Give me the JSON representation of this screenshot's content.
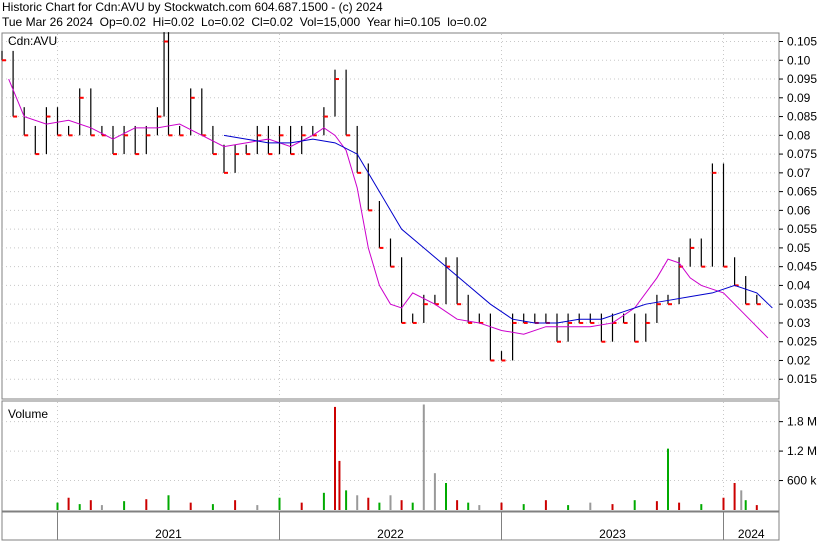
{
  "header": {
    "line1": "Historic Chart for Cdn:AVU by Stockwatch.com 604.687.1500 - (c) 2024",
    "line2": "Tue Mar 26 2024  Op=0.02  Hi=0.02  Lo=0.02  Cl=0.02  Vol=15,000  Year hi=0.105  lo=0.02"
  },
  "colors": {
    "bar": "#000000",
    "close_dot": "#ff0000",
    "ma_short": "#cc00cc",
    "ma_long": "#0000cc",
    "vol_up": "#00aa00",
    "vol_down": "#cc0000",
    "vol_flat": "#999999",
    "grid": "#c8c8c8"
  },
  "chart_data": [
    {
      "type": "line",
      "title": "Cdn:AVU",
      "ylim": [
        0.01,
        0.107
      ],
      "xlim": [
        2020.75,
        2024.25
      ],
      "x_ticks": [
        "2021",
        "2022",
        "2023",
        "2024"
      ],
      "y_ticks": [
        "0.105",
        "0.10",
        "0.095",
        "0.09",
        "0.085",
        "0.08",
        "0.075",
        "0.07",
        "0.065",
        "0.06",
        "0.055",
        "0.05",
        "0.045",
        "0.04",
        "0.035",
        "0.03",
        "0.025",
        "0.02",
        "0.015"
      ],
      "grid": true,
      "price_points": [
        [
          2020.75,
          0.1
        ],
        [
          2020.8,
          0.085
        ],
        [
          2020.85,
          0.08
        ],
        [
          2020.9,
          0.075
        ],
        [
          2020.95,
          0.085
        ],
        [
          2021.0,
          0.08
        ],
        [
          2021.05,
          0.08
        ],
        [
          2021.1,
          0.09
        ],
        [
          2021.15,
          0.08
        ],
        [
          2021.2,
          0.08
        ],
        [
          2021.25,
          0.075
        ],
        [
          2021.3,
          0.08
        ],
        [
          2021.35,
          0.075
        ],
        [
          2021.4,
          0.08
        ],
        [
          2021.45,
          0.085
        ],
        [
          2021.48,
          0.105
        ],
        [
          2021.5,
          0.08
        ],
        [
          2021.55,
          0.08
        ],
        [
          2021.6,
          0.09
        ],
        [
          2021.65,
          0.08
        ],
        [
          2021.7,
          0.075
        ],
        [
          2021.75,
          0.07
        ],
        [
          2021.8,
          0.075
        ],
        [
          2021.85,
          0.075
        ],
        [
          2021.9,
          0.08
        ],
        [
          2021.95,
          0.075
        ],
        [
          2022.0,
          0.08
        ],
        [
          2022.05,
          0.075
        ],
        [
          2022.1,
          0.08
        ],
        [
          2022.15,
          0.08
        ],
        [
          2022.2,
          0.085
        ],
        [
          2022.25,
          0.095
        ],
        [
          2022.3,
          0.08
        ],
        [
          2022.35,
          0.07
        ],
        [
          2022.4,
          0.06
        ],
        [
          2022.45,
          0.05
        ],
        [
          2022.5,
          0.045
        ],
        [
          2022.55,
          0.03
        ],
        [
          2022.6,
          0.03
        ],
        [
          2022.65,
          0.035
        ],
        [
          2022.7,
          0.035
        ],
        [
          2022.75,
          0.045
        ],
        [
          2022.8,
          0.035
        ],
        [
          2022.85,
          0.03
        ],
        [
          2022.9,
          0.03
        ],
        [
          2022.95,
          0.02
        ],
        [
          2023.0,
          0.02
        ],
        [
          2023.05,
          0.03
        ],
        [
          2023.1,
          0.03
        ],
        [
          2023.15,
          0.03
        ],
        [
          2023.2,
          0.03
        ],
        [
          2023.25,
          0.025
        ],
        [
          2023.3,
          0.03
        ],
        [
          2023.35,
          0.03
        ],
        [
          2023.4,
          0.03
        ],
        [
          2023.45,
          0.025
        ],
        [
          2023.5,
          0.03
        ],
        [
          2023.55,
          0.03
        ],
        [
          2023.6,
          0.025
        ],
        [
          2023.65,
          0.03
        ],
        [
          2023.7,
          0.035
        ],
        [
          2023.75,
          0.035
        ],
        [
          2023.8,
          0.045
        ],
        [
          2023.85,
          0.05
        ],
        [
          2023.9,
          0.045
        ],
        [
          2023.95,
          0.07
        ],
        [
          2024.0,
          0.045
        ],
        [
          2024.05,
          0.04
        ],
        [
          2024.1,
          0.035
        ],
        [
          2024.15,
          0.035
        ]
      ],
      "ma_short": [
        [
          2020.78,
          0.095
        ],
        [
          2020.85,
          0.085
        ],
        [
          2020.95,
          0.083
        ],
        [
          2021.05,
          0.084
        ],
        [
          2021.15,
          0.082
        ],
        [
          2021.25,
          0.079
        ],
        [
          2021.35,
          0.082
        ],
        [
          2021.45,
          0.082
        ],
        [
          2021.55,
          0.083
        ],
        [
          2021.65,
          0.08
        ],
        [
          2021.75,
          0.077
        ],
        [
          2021.85,
          0.078
        ],
        [
          2021.95,
          0.079
        ],
        [
          2022.05,
          0.077
        ],
        [
          2022.15,
          0.08
        ],
        [
          2022.2,
          0.082
        ],
        [
          2022.25,
          0.08
        ],
        [
          2022.3,
          0.076
        ],
        [
          2022.35,
          0.066
        ],
        [
          2022.4,
          0.05
        ],
        [
          2022.45,
          0.04
        ],
        [
          2022.5,
          0.035
        ],
        [
          2022.55,
          0.034
        ],
        [
          2022.6,
          0.038
        ],
        [
          2022.7,
          0.035
        ],
        [
          2022.8,
          0.031
        ],
        [
          2022.9,
          0.03
        ],
        [
          2023.0,
          0.028
        ],
        [
          2023.1,
          0.027
        ],
        [
          2023.2,
          0.029
        ],
        [
          2023.3,
          0.029
        ],
        [
          2023.4,
          0.029
        ],
        [
          2023.5,
          0.03
        ],
        [
          2023.6,
          0.034
        ],
        [
          2023.7,
          0.042
        ],
        [
          2023.75,
          0.047
        ],
        [
          2023.8,
          0.046
        ],
        [
          2023.85,
          0.042
        ],
        [
          2023.9,
          0.04
        ],
        [
          2023.95,
          0.039
        ],
        [
          2024.0,
          0.038
        ],
        [
          2024.05,
          0.035
        ],
        [
          2024.1,
          0.032
        ],
        [
          2024.15,
          0.029
        ],
        [
          2024.2,
          0.026
        ]
      ],
      "ma_long": [
        [
          2021.75,
          0.08
        ],
        [
          2021.85,
          0.079
        ],
        [
          2021.95,
          0.078
        ],
        [
          2022.05,
          0.078
        ],
        [
          2022.15,
          0.079
        ],
        [
          2022.25,
          0.078
        ],
        [
          2022.35,
          0.075
        ],
        [
          2022.45,
          0.065
        ],
        [
          2022.55,
          0.055
        ],
        [
          2022.65,
          0.05
        ],
        [
          2022.75,
          0.045
        ],
        [
          2022.85,
          0.04
        ],
        [
          2022.95,
          0.035
        ],
        [
          2023.05,
          0.031
        ],
        [
          2023.15,
          0.03
        ],
        [
          2023.25,
          0.03
        ],
        [
          2023.35,
          0.031
        ],
        [
          2023.45,
          0.031
        ],
        [
          2023.55,
          0.033
        ],
        [
          2023.65,
          0.035
        ],
        [
          2023.75,
          0.036
        ],
        [
          2023.85,
          0.037
        ],
        [
          2023.95,
          0.038
        ],
        [
          2024.05,
          0.04
        ],
        [
          2024.15,
          0.038
        ],
        [
          2024.22,
          0.034
        ]
      ]
    },
    {
      "type": "bar",
      "title": "Volume",
      "ylim": [
        0,
        2200000
      ],
      "y_ticks": [
        "1.8 M",
        "1.2 M",
        "600 k"
      ],
      "y_tick_values": [
        1800000,
        1200000,
        600000
      ],
      "volume_bars": [
        [
          2021.0,
          150000,
          "up"
        ],
        [
          2021.05,
          250000,
          "down"
        ],
        [
          2021.1,
          120000,
          "up"
        ],
        [
          2021.15,
          200000,
          "down"
        ],
        [
          2021.2,
          100000,
          "flat"
        ],
        [
          2021.3,
          180000,
          "up"
        ],
        [
          2021.4,
          220000,
          "down"
        ],
        [
          2021.5,
          300000,
          "up"
        ],
        [
          2021.6,
          150000,
          "down"
        ],
        [
          2021.7,
          120000,
          "up"
        ],
        [
          2021.8,
          200000,
          "down"
        ],
        [
          2021.9,
          100000,
          "flat"
        ],
        [
          2022.0,
          250000,
          "up"
        ],
        [
          2022.1,
          150000,
          "down"
        ],
        [
          2022.2,
          350000,
          "up"
        ],
        [
          2022.25,
          2100000,
          "down"
        ],
        [
          2022.27,
          1000000,
          "down"
        ],
        [
          2022.3,
          400000,
          "up"
        ],
        [
          2022.35,
          300000,
          "flat"
        ],
        [
          2022.4,
          250000,
          "down"
        ],
        [
          2022.45,
          150000,
          "up"
        ],
        [
          2022.5,
          300000,
          "flat"
        ],
        [
          2022.55,
          200000,
          "down"
        ],
        [
          2022.6,
          150000,
          "up"
        ],
        [
          2022.65,
          2150000,
          "flat"
        ],
        [
          2022.7,
          750000,
          "flat"
        ],
        [
          2022.75,
          550000,
          "up"
        ],
        [
          2022.8,
          200000,
          "down"
        ],
        [
          2022.85,
          150000,
          "up"
        ],
        [
          2022.9,
          100000,
          "flat"
        ],
        [
          2023.0,
          150000,
          "down"
        ],
        [
          2023.1,
          120000,
          "up"
        ],
        [
          2023.2,
          200000,
          "down"
        ],
        [
          2023.3,
          100000,
          "up"
        ],
        [
          2023.4,
          150000,
          "flat"
        ],
        [
          2023.5,
          120000,
          "down"
        ],
        [
          2023.6,
          200000,
          "up"
        ],
        [
          2023.7,
          180000,
          "down"
        ],
        [
          2023.75,
          1250000,
          "up"
        ],
        [
          2023.8,
          150000,
          "down"
        ],
        [
          2023.9,
          120000,
          "up"
        ],
        [
          2024.0,
          250000,
          "down"
        ],
        [
          2024.05,
          550000,
          "down"
        ],
        [
          2024.08,
          400000,
          "flat"
        ],
        [
          2024.1,
          200000,
          "up"
        ],
        [
          2024.15,
          100000,
          "down"
        ]
      ]
    }
  ]
}
